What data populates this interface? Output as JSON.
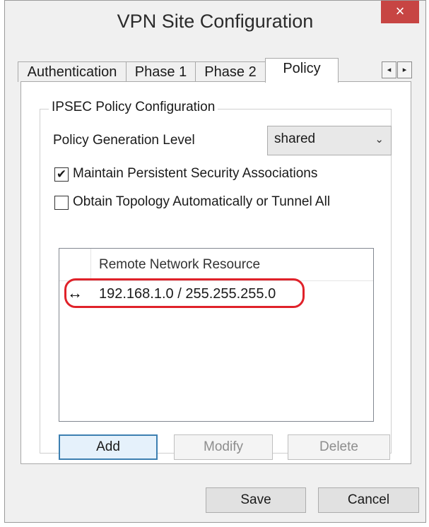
{
  "window": {
    "title": "VPN Site Configuration",
    "close_glyph": "×"
  },
  "tabs": [
    {
      "label": "Authentication",
      "active": false
    },
    {
      "label": "Phase 1",
      "active": false
    },
    {
      "label": "Phase 2",
      "active": false
    },
    {
      "label": "Policy",
      "active": true
    }
  ],
  "tab_scroll": {
    "left_glyph": "◂",
    "right_glyph": "▸"
  },
  "policy": {
    "group_title": "IPSEC Policy Configuration",
    "generation_level_label": "Policy Generation Level",
    "generation_level_value": "shared",
    "dropdown_glyph": "⌄",
    "persistent_sa_label": "Maintain Persistent Security Associations",
    "persistent_sa_checked": true,
    "obtain_topology_label": "Obtain Topology Automatically or Tunnel All",
    "obtain_topology_checked": false,
    "check_glyph": "✔",
    "resource_list": {
      "column_header": "Remote Network Resource",
      "rows": [
        {
          "icon": "bidirectional-arrow-icon",
          "glyph": "↔",
          "value": "192.168.1.0 / 255.255.255.0"
        }
      ]
    },
    "buttons": {
      "add": "Add",
      "modify": "Modify",
      "delete": "Delete"
    }
  },
  "footer": {
    "save": "Save",
    "cancel": "Cancel"
  },
  "colors": {
    "close_button": "#c74543",
    "highlight": "#e0222a",
    "default_button_border": "#3c7fb1"
  }
}
